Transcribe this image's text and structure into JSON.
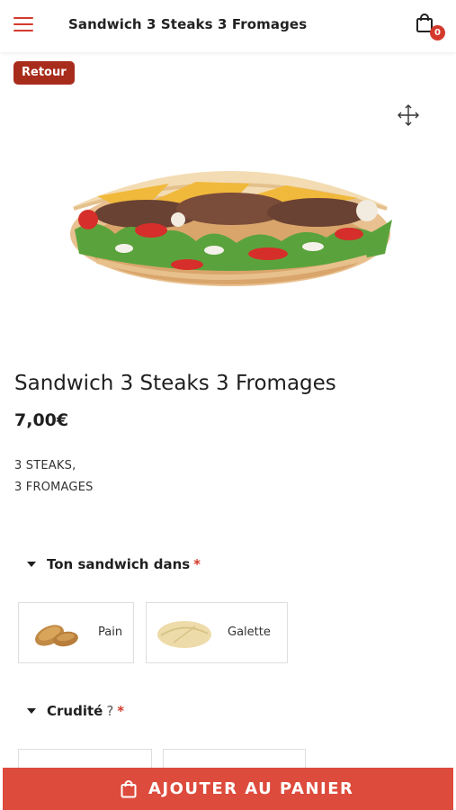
{
  "header": {
    "title": "Sandwich 3 Steaks 3 Fromages",
    "cart_count": "0"
  },
  "back_label": "Retour",
  "product": {
    "title": "Sandwich 3 Steaks 3 Fromages",
    "price": "7,00€",
    "description_lines": [
      "3 STEAKS,",
      "3 FROMAGES"
    ]
  },
  "sections": [
    {
      "title": "Ton sandwich dans",
      "required_mark": "*",
      "options": [
        {
          "label": "Pain"
        },
        {
          "label": "Galette"
        }
      ]
    },
    {
      "title": "Crudité",
      "question_mark": "?",
      "required_mark": "*"
    }
  ],
  "add_to_cart_label": "AJOUTER AU PANIER",
  "colors": {
    "accent": "#dd4b3c",
    "back_button": "#a82c1c",
    "icon_red": "#d33a2c"
  }
}
